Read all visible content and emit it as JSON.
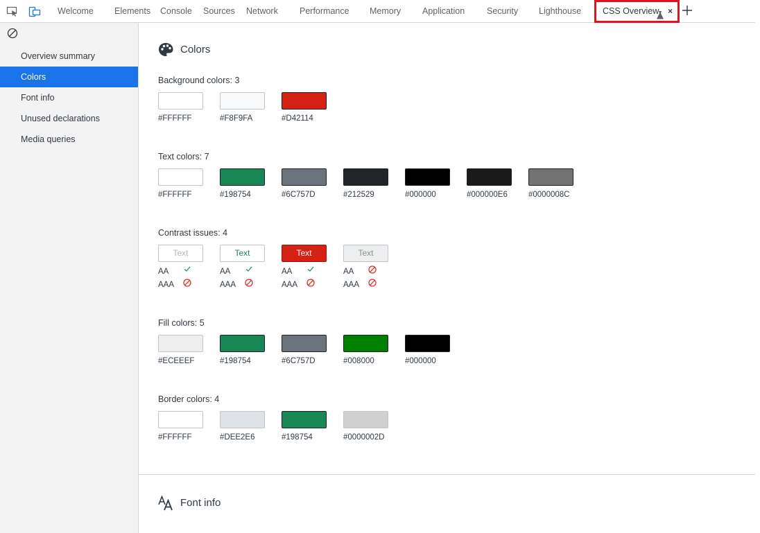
{
  "toolbar": {
    "icons": [
      "inspect-element-icon",
      "device-toolbar-icon"
    ],
    "tabs": [
      {
        "label": "Welcome"
      },
      {
        "label": "Elements"
      },
      {
        "label": "Console"
      },
      {
        "label": "Sources"
      },
      {
        "label": "Network"
      },
      {
        "label": "Performance"
      },
      {
        "label": "Memory"
      },
      {
        "label": "Application"
      },
      {
        "label": "Security"
      },
      {
        "label": "Lighthouse"
      }
    ],
    "active_tab": {
      "label": "CSS Overview",
      "icon": "flask-icon",
      "close": "×"
    },
    "highlight_color": "#e0141e"
  },
  "sidebar": {
    "items": [
      {
        "label": "Overview summary"
      },
      {
        "label": "Colors"
      },
      {
        "label": "Font info"
      },
      {
        "label": "Unused declarations"
      },
      {
        "label": "Media queries"
      }
    ],
    "selected_index": 1,
    "selected_color": "#1a73e8"
  },
  "colors_section": {
    "title": "Colors",
    "background": {
      "title": "Background colors: 3",
      "swatches": [
        {
          "hex": "#FFFFFF",
          "color": "#FFFFFF"
        },
        {
          "hex": "#F8F9FA",
          "color": "#F8F9FA"
        },
        {
          "hex": "#D42114",
          "color": "#D42114"
        }
      ]
    },
    "text": {
      "title": "Text colors: 7",
      "swatches": [
        {
          "hex": "#FFFFFF",
          "color": "#FFFFFF"
        },
        {
          "hex": "#198754",
          "color": "#198754"
        },
        {
          "hex": "#6C757D",
          "color": "#6C757D"
        },
        {
          "hex": "#212529",
          "color": "#212529"
        },
        {
          "hex": "#000000",
          "color": "#000000"
        },
        {
          "hex": "#000000E6",
          "color": "#1A1A1A"
        },
        {
          "hex": "#0000008C",
          "color": "#737373"
        }
      ]
    },
    "contrast": {
      "title": "Contrast issues: 4",
      "aa_label": "AA",
      "aaa_label": "AAA",
      "items": [
        {
          "text": "Text",
          "bg": "#FFFFFF",
          "fg": "#b5b5b5",
          "aa": "pass",
          "aaa": "fail"
        },
        {
          "text": "Text",
          "bg": "#FFFFFF",
          "fg": "#198754",
          "aa": "pass",
          "aaa": "fail"
        },
        {
          "text": "Text",
          "bg": "#D42114",
          "fg": "#FFFFFF",
          "aa": "pass",
          "aaa": "fail"
        },
        {
          "text": "Text",
          "bg": "#ECEEEF",
          "fg": "#8e8e8e",
          "aa": "fail",
          "aaa": "fail"
        }
      ]
    },
    "fill": {
      "title": "Fill colors: 5",
      "swatches": [
        {
          "hex": "#ECEEEF",
          "color": "#ECEEEF"
        },
        {
          "hex": "#198754",
          "color": "#198754"
        },
        {
          "hex": "#6C757D",
          "color": "#6C757D"
        },
        {
          "hex": "#008000",
          "color": "#008000"
        },
        {
          "hex": "#000000",
          "color": "#000000"
        }
      ]
    },
    "border": {
      "title": "Border colors: 4",
      "swatches": [
        {
          "hex": "#FFFFFF",
          "color": "#FFFFFF"
        },
        {
          "hex": "#DEE2E6",
          "color": "#DEE2E6"
        },
        {
          "hex": "#198754",
          "color": "#198754"
        },
        {
          "hex": "#0000002D",
          "color": "#D0D0D0"
        }
      ]
    }
  },
  "font_section": {
    "title": "Font info"
  }
}
